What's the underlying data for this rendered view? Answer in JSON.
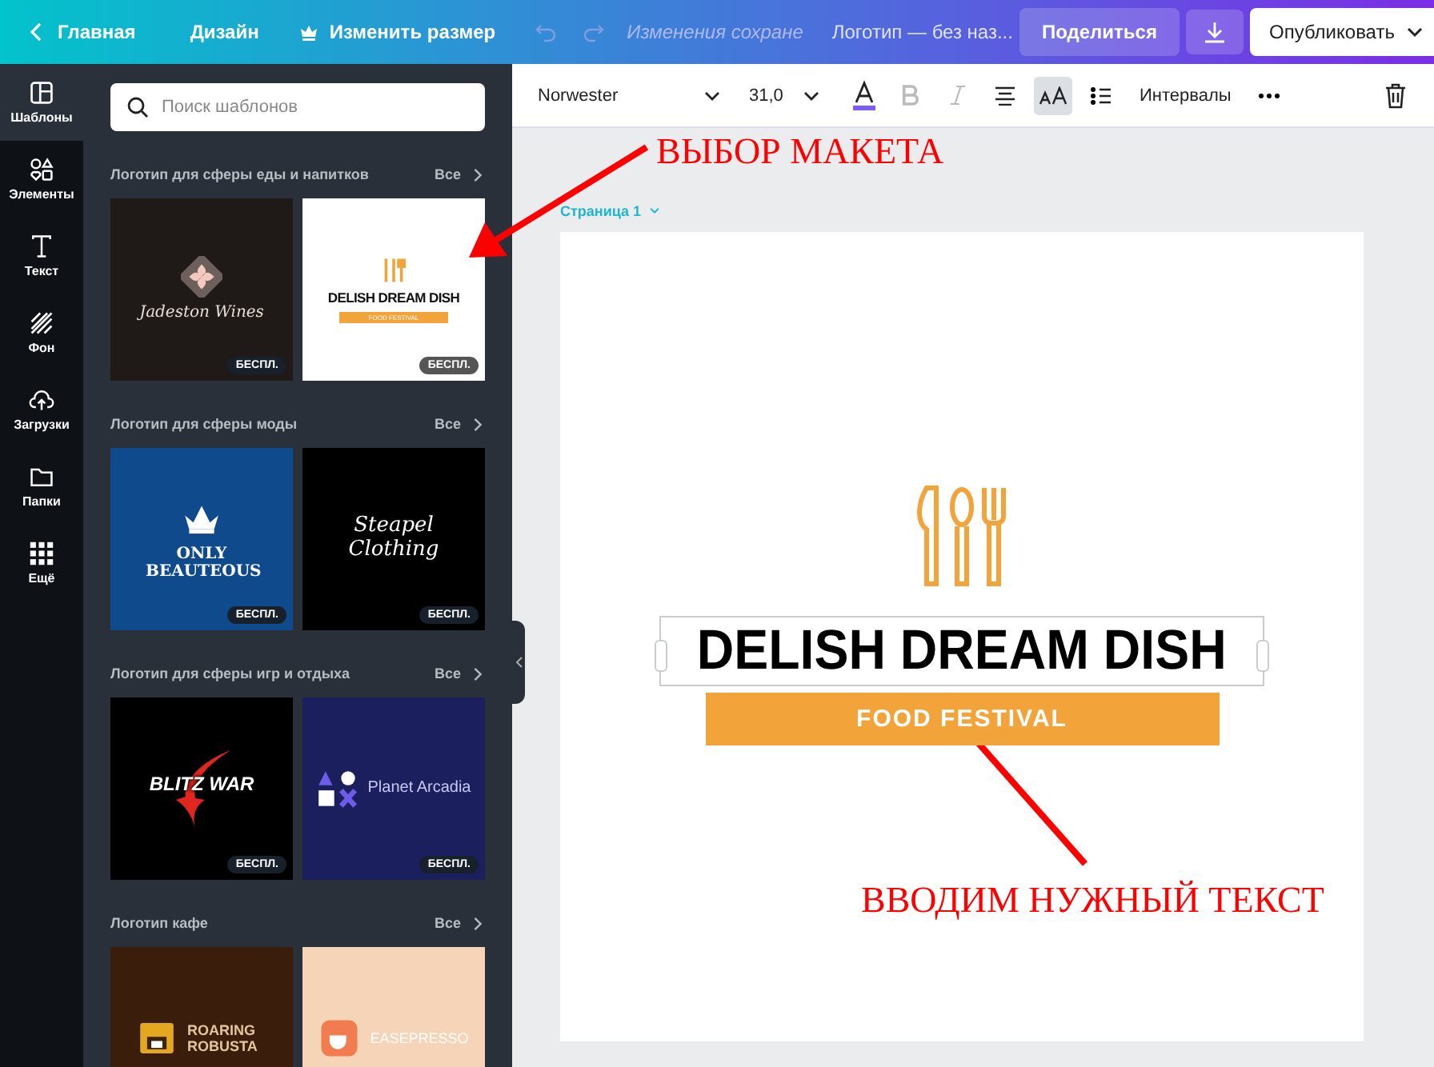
{
  "topbar": {
    "back": "Главная",
    "design": "Дизайн",
    "resize": "Изменить размер",
    "status": "Изменения сохране",
    "title": "Логотип — без наз...",
    "share": "Поделиться",
    "publish": "Опубликовать"
  },
  "rail": [
    {
      "kind": "templates",
      "label": "Шаблоны",
      "selected": true
    },
    {
      "kind": "elements",
      "label": "Элементы",
      "selected": false
    },
    {
      "kind": "text",
      "label": "Текст",
      "selected": false
    },
    {
      "kind": "background",
      "label": "Фон",
      "selected": false
    },
    {
      "kind": "uploads",
      "label": "Загрузки",
      "selected": false
    },
    {
      "kind": "folders",
      "label": "Папки",
      "selected": false
    },
    {
      "kind": "more",
      "label": "Ещё",
      "selected": false
    }
  ],
  "panel": {
    "search": {
      "placeholder": "Поиск шаблонов"
    },
    "sections": [
      {
        "title": "Логотип для сферы еды и напитков",
        "see_all": "Все",
        "templates": [
          {
            "kind": "wine",
            "title": "Jadeston Wines",
            "badge": "БЕСПЛ."
          },
          {
            "kind": "food",
            "title": "DELISH DREAM DISH",
            "subtitle": "FOOD FESTIVAL",
            "badge": "БЕСПЛ."
          }
        ]
      },
      {
        "title": "Логотип для сферы моды",
        "see_all": "Все",
        "templates": [
          {
            "kind": "crown",
            "title": "ONLY BEAUTEOUS",
            "badge": "БЕСПЛ."
          },
          {
            "kind": "script",
            "title": "Steapel Clothing",
            "badge": "БЕСПЛ."
          }
        ]
      },
      {
        "title": "Логотип для сферы игр и отдыха",
        "see_all": "Все",
        "templates": [
          {
            "kind": "blitz",
            "title": "BLITZ WAR",
            "badge": "БЕСПЛ."
          },
          {
            "kind": "arcade",
            "title": "Planet Arcadia",
            "badge": "БЕСПЛ."
          }
        ]
      },
      {
        "title": "Логотип кафе",
        "see_all": "Все",
        "templates": [
          {
            "kind": "coffee",
            "title": "ROARING ROBUSTA"
          },
          {
            "kind": "cafe",
            "title": "EASEPRESSO"
          }
        ]
      }
    ]
  },
  "toolbar": {
    "font": "Norwester",
    "size": "31,0",
    "bold_disabled": true,
    "italic_disabled": true,
    "case_selected": true,
    "spacing": "Интервалы"
  },
  "page": {
    "label": "Страница 1",
    "heading": "DELISH DREAM DISH",
    "banner": "FOOD FESTIVAL"
  },
  "annotations": [
    {
      "text": "ВЫБОР МАКЕТА"
    },
    {
      "text": "ВВОДИМ НУЖНЫЙ ТЕКСТ"
    }
  ]
}
